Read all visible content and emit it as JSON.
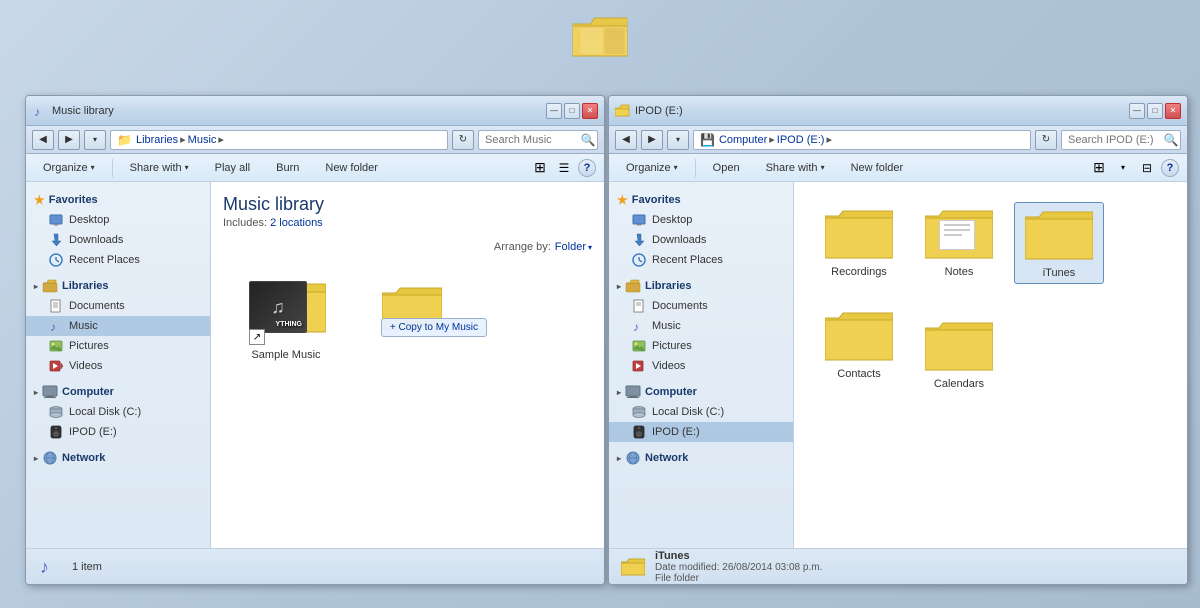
{
  "topFolder": {
    "label": "Folder"
  },
  "leftWindow": {
    "titleBar": {
      "minimizeLabel": "—",
      "maximizeLabel": "□",
      "closeLabel": "✕"
    },
    "addressBar": {
      "backLabel": "◀",
      "forwardLabel": "▶",
      "upLabel": "▲",
      "recentLabel": "▾",
      "path": [
        "Libraries",
        "Music"
      ],
      "searchPlaceholder": "Search Music",
      "refreshLabel": "↻"
    },
    "toolbar": {
      "organizeLabel": "Organize",
      "shareWithLabel": "Share with",
      "playAllLabel": "Play all",
      "burnLabel": "Burn",
      "newFolderLabel": "New folder"
    },
    "sidebar": {
      "favoritesLabel": "Favorites",
      "items": [
        {
          "label": "Desktop",
          "icon": "desktop"
        },
        {
          "label": "Downloads",
          "icon": "download"
        },
        {
          "label": "Recent Places",
          "icon": "recent"
        }
      ],
      "librariesLabel": "Libraries",
      "libraryItems": [
        {
          "label": "Documents",
          "icon": "docs"
        },
        {
          "label": "Music",
          "icon": "music",
          "selected": true
        },
        {
          "label": "Pictures",
          "icon": "pictures"
        },
        {
          "label": "Videos",
          "icon": "videos"
        }
      ],
      "computerLabel": "Computer",
      "computerItems": [
        {
          "label": "Local Disk (C:)",
          "icon": "disk"
        },
        {
          "label": "IPOD (E:)",
          "icon": "disk"
        }
      ],
      "networkLabel": "Network"
    },
    "main": {
      "libraryTitle": "Music library",
      "includesLabel": "Includes:",
      "locationsLabel": "2 locations",
      "arrangeByLabel": "Arrange by:",
      "folderLabel": "Folder",
      "files": [
        {
          "label": "Sample Music",
          "type": "folder-music"
        },
        {
          "label": "",
          "type": "folder-plain",
          "overlay": "+ Copy to My Music"
        }
      ]
    },
    "statusBar": {
      "countLabel": "1 item"
    }
  },
  "rightWindow": {
    "titleBar": {
      "minimizeLabel": "—",
      "maximizeLabel": "□",
      "closeLabel": "✕"
    },
    "addressBar": {
      "backLabel": "◀",
      "forwardLabel": "▶",
      "upLabel": "▲",
      "recentLabel": "▾",
      "path": [
        "Computer",
        "IPOD (E:)"
      ],
      "searchPlaceholder": "Search IPOD (E:)",
      "refreshLabel": "↻"
    },
    "toolbar": {
      "organizeLabel": "Organize",
      "openLabel": "Open",
      "shareWithLabel": "Share with",
      "newFolderLabel": "New folder"
    },
    "sidebar": {
      "favoritesLabel": "Favorites",
      "items": [
        {
          "label": "Desktop",
          "icon": "desktop"
        },
        {
          "label": "Downloads",
          "icon": "download"
        },
        {
          "label": "Recent Places",
          "icon": "recent"
        }
      ],
      "librariesLabel": "Libraries",
      "libraryItems": [
        {
          "label": "Documents",
          "icon": "docs"
        },
        {
          "label": "Music",
          "icon": "music"
        },
        {
          "label": "Pictures",
          "icon": "pictures"
        },
        {
          "label": "Videos",
          "icon": "videos"
        }
      ],
      "computerLabel": "Computer",
      "computerItems": [
        {
          "label": "Local Disk (C:)",
          "icon": "disk"
        },
        {
          "label": "IPOD (E:)",
          "icon": "disk",
          "selected": true
        }
      ],
      "networkLabel": "Network"
    },
    "main": {
      "folders": [
        {
          "label": "Recordings",
          "type": "folder-plain"
        },
        {
          "label": "Notes",
          "type": "folder-notes"
        },
        {
          "label": "iTunes",
          "type": "folder-plain",
          "selected": true
        },
        {
          "label": "Contacts",
          "type": "folder-plain"
        },
        {
          "label": "Calendars",
          "type": "folder-plain"
        }
      ]
    },
    "statusBar": {
      "folderIcon": true,
      "folderName": "iTunes",
      "dateModifiedLabel": "Date modified:",
      "dateModifiedValue": "26/08/2014 03:08 p.m.",
      "typeLabel": "File folder"
    }
  }
}
